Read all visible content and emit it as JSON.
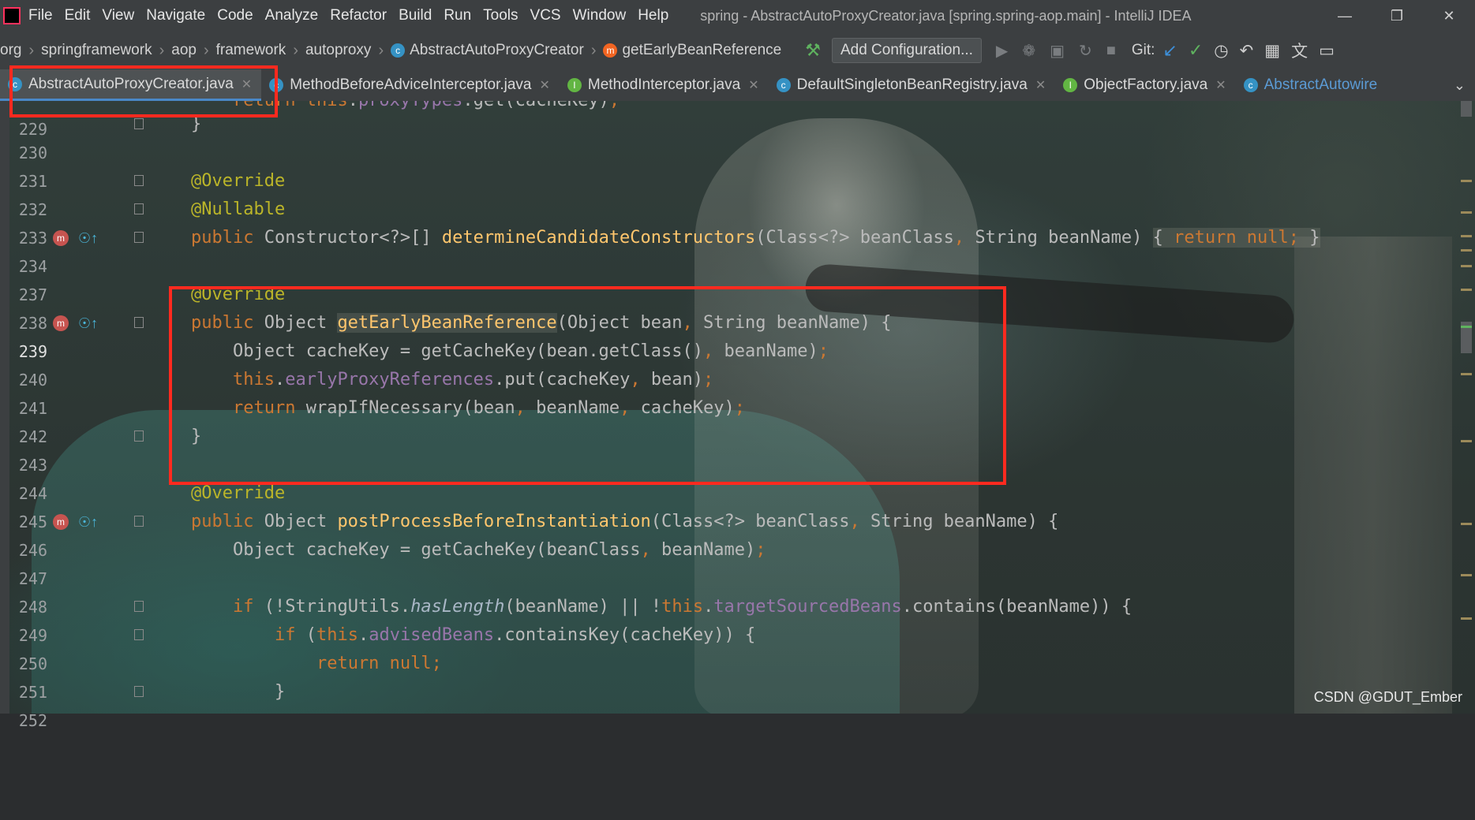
{
  "menubar": {
    "items": [
      "File",
      "Edit",
      "View",
      "Navigate",
      "Code",
      "Analyze",
      "Refactor",
      "Build",
      "Run",
      "Tools",
      "VCS",
      "Window",
      "Help"
    ],
    "window_title": "spring - AbstractAutoProxyCreator.java [spring.spring-aop.main] - IntelliJ IDEA"
  },
  "breadcrumb": {
    "items": [
      "org",
      "springframework",
      "aop",
      "framework",
      "autoproxy",
      "AbstractAutoProxyCreator",
      "getEarlyBeanReference"
    ]
  },
  "toolbar": {
    "add_config_label": "Add Configuration...",
    "git_label": "Git:"
  },
  "tabs": [
    {
      "label": "AbstractAutoProxyCreator.java",
      "icon": "class-icon",
      "active": true
    },
    {
      "label": "MethodBeforeAdviceInterceptor.java",
      "icon": "class-icon"
    },
    {
      "label": "MethodInterceptor.java",
      "icon": "interface-icon"
    },
    {
      "label": "DefaultSingletonBeanRegistry.java",
      "icon": "class-icon"
    },
    {
      "label": "ObjectFactory.java",
      "icon": "interface-icon"
    },
    {
      "label": "AbstractAutowire",
      "icon": "class-icon"
    }
  ],
  "editor": {
    "line_numbers": [
      "229",
      "230",
      "231",
      "232",
      "233",
      "234",
      "237",
      "238",
      "239",
      "240",
      "241",
      "242",
      "243",
      "244",
      "245",
      "246",
      "247",
      "248",
      "249",
      "250",
      "251",
      "252"
    ],
    "current_line": "239"
  },
  "watermark": "CSDN @GDUT_Ember",
  "colors": {
    "keyword": "#cc7832",
    "annotation": "#bbb529",
    "method": "#ffc66d",
    "field": "#9876aa",
    "highlight_box": "#ff2a1f"
  }
}
